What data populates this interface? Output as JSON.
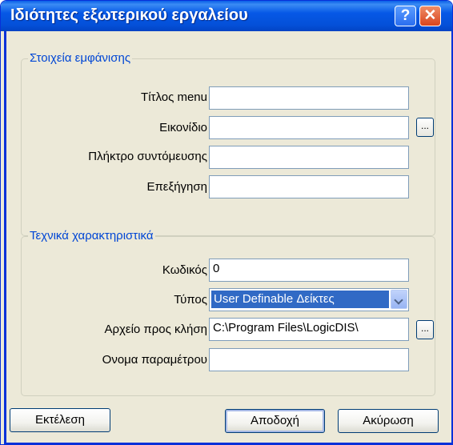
{
  "window": {
    "title": "Ιδιότητες εξωτερικού εργαλείου",
    "help_label": "?",
    "close_label": "✕"
  },
  "display_group": {
    "title": "Στοιχεία εμφάνισης",
    "fields": [
      {
        "label": "Τίτλος menu",
        "value": ""
      },
      {
        "label": "Εικονίδιο",
        "value": ""
      },
      {
        "label": "Πλήκτρο συντόμευσης",
        "value": ""
      },
      {
        "label": "Επεξήγηση",
        "value": ""
      }
    ],
    "browse_label": "..."
  },
  "tech_group": {
    "title": "Τεχνικά χαρακτηριστικά",
    "code_label": "Κωδικός",
    "code_value": "0",
    "type_label": "Τύπος",
    "type_value": "User Definable Δείκτες",
    "file_label": "Αρχείο προς κλήση",
    "file_value": "C:\\Program Files\\LogicDIS\\",
    "param_label": "Ονομα παραμέτρου",
    "param_value": "",
    "browse_label": "..."
  },
  "buttons": {
    "execute": "Εκτέλεση",
    "ok": "Αποδοχή",
    "cancel": "Ακύρωση"
  }
}
